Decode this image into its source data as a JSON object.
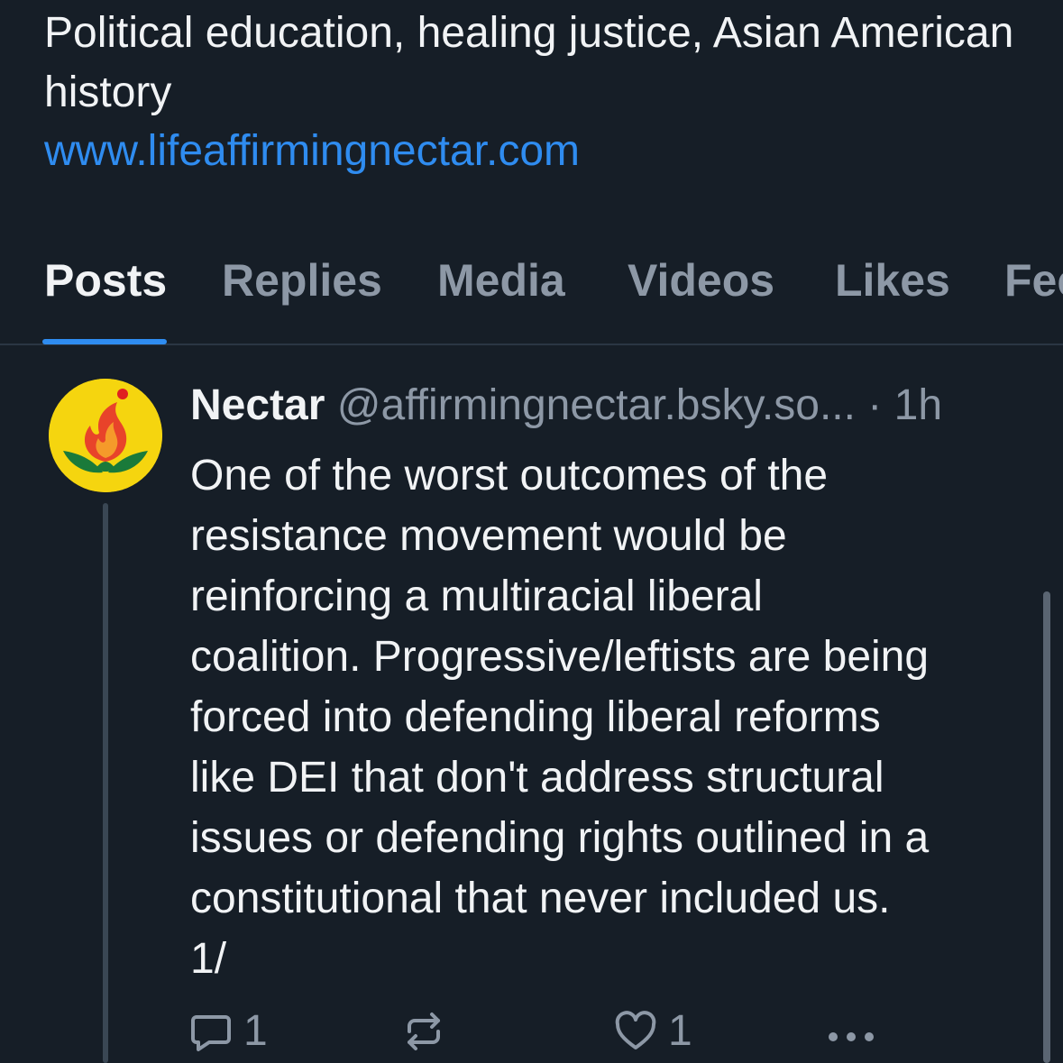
{
  "profile": {
    "bio": "Political education, healing justice, Asian American history",
    "link": "www.lifeaffirmingnectar.com"
  },
  "tabs": [
    {
      "label": "Posts",
      "active": true
    },
    {
      "label": "Replies",
      "active": false
    },
    {
      "label": "Media",
      "active": false
    },
    {
      "label": "Videos",
      "active": false
    },
    {
      "label": "Likes",
      "active": false
    },
    {
      "label": "Feeds",
      "active": false
    }
  ],
  "post": {
    "author_name": "Nectar",
    "author_handle": "@affirmingnectar.bsky.so...",
    "time": "· 1h",
    "text": "One of the worst outcomes of the\nresistance movement would be\nreinforcing a multiracial liberal\ncoalition. Progressive/leftists are being\nforced into defending liberal reforms\nlike DEI that don't address structural\nissues or defending rights outlined in a\nconstitutional that never included us.\n1/",
    "reply_count": "1",
    "like_count": "1"
  },
  "icons": {
    "reply": "speech-bubble-icon",
    "repost": "repost-arrows-icon",
    "like": "heart-icon",
    "more": "ellipsis-icon",
    "avatar": "flame-lotus-logo"
  },
  "colors": {
    "background": "#161e27",
    "accent": "#2f8cf0",
    "muted": "#8d98a6",
    "text": "#f1f3f5",
    "avatar_bg": "#f5d50f"
  }
}
